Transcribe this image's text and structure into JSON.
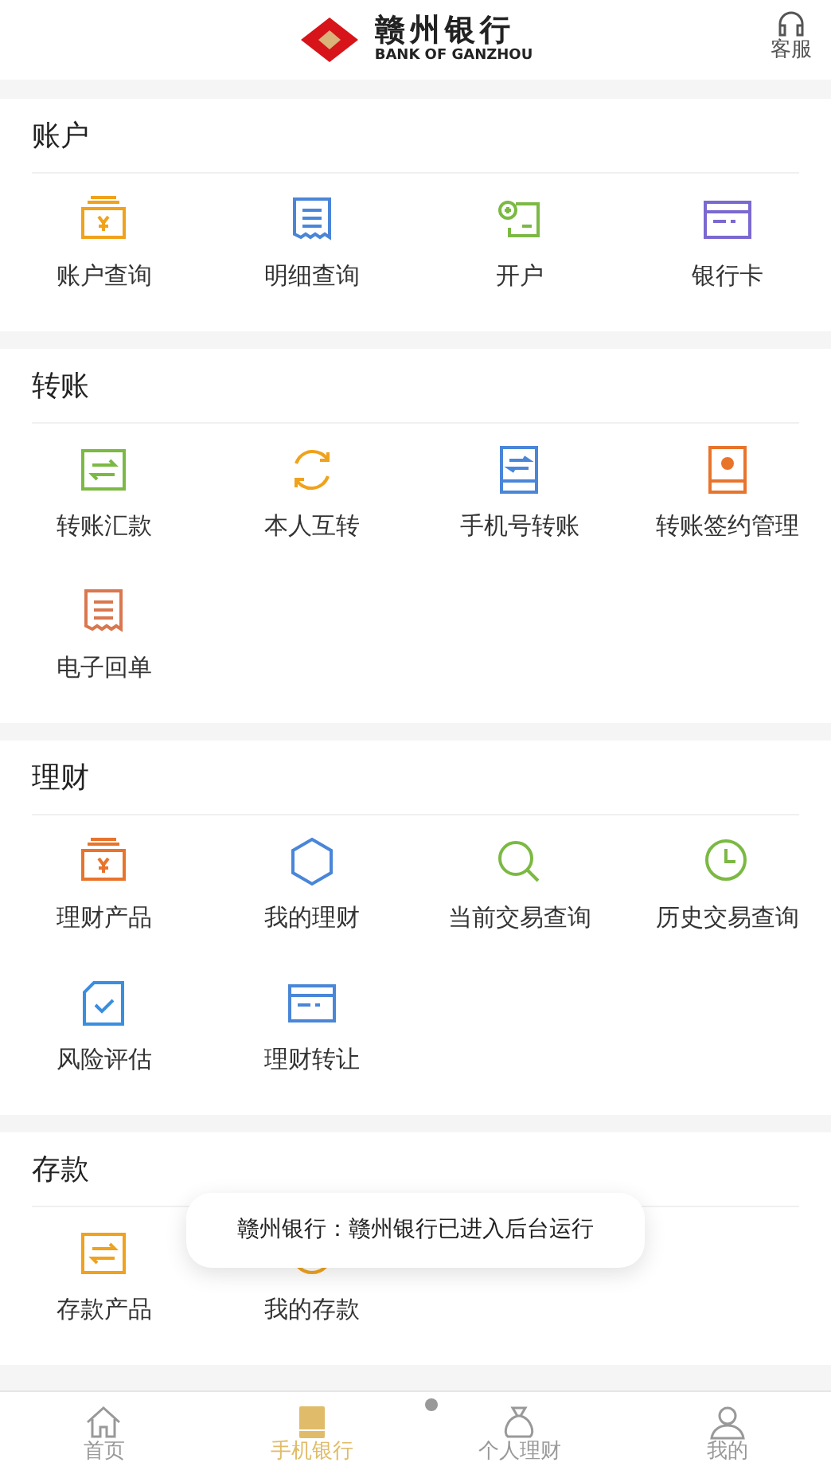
{
  "header": {
    "logo_cn": "赣州银行",
    "logo_en": "BANK OF GANZHOU",
    "service": "客服"
  },
  "sections": [
    {
      "title": "账户",
      "items": [
        "账户查询",
        "明细查询",
        "开户",
        "银行卡"
      ]
    },
    {
      "title": "转账",
      "items": [
        "转账汇款",
        "本人互转",
        "手机号转账",
        "转账签约管理",
        "电子回单"
      ]
    },
    {
      "title": "理财",
      "items": [
        "理财产品",
        "我的理财",
        "当前交易查询",
        "历史交易查询",
        "风险评估",
        "理财转让"
      ]
    },
    {
      "title": "存款",
      "items": [
        "存款产品",
        "我的存款"
      ]
    }
  ],
  "toast": "赣州银行：赣州银行已进入后台运行",
  "tabs": [
    {
      "label": "首页",
      "selected": false
    },
    {
      "label": "手机银行",
      "selected": true
    },
    {
      "label": "个人理财",
      "selected": false
    },
    {
      "label": "我的",
      "selected": false
    }
  ]
}
